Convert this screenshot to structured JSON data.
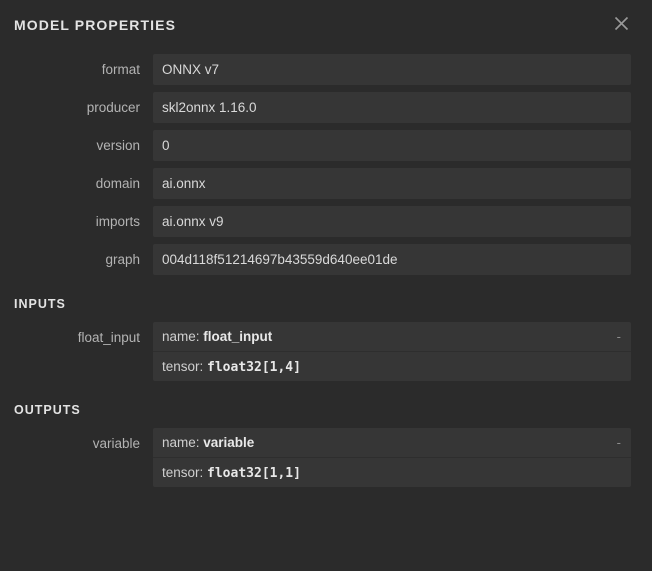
{
  "panel": {
    "title": "MODEL PROPERTIES",
    "close_icon": "close-icon"
  },
  "properties": [
    {
      "label": "format",
      "value": "ONNX v7"
    },
    {
      "label": "producer",
      "value": "skl2onnx 1.16.0"
    },
    {
      "label": "version",
      "value": "0"
    },
    {
      "label": "domain",
      "value": "ai.onnx"
    },
    {
      "label": "imports",
      "value": "ai.onnx v9"
    },
    {
      "label": "graph",
      "value": "004d118f51214697b43559d640ee01de"
    }
  ],
  "inputs": {
    "header": "INPUTS",
    "items": [
      {
        "label": "float_input",
        "name_key": "name:",
        "name_value": "float_input",
        "tensor_key": "tensor:",
        "tensor_value": "float32[1,4]",
        "trailing": "-"
      }
    ]
  },
  "outputs": {
    "header": "OUTPUTS",
    "items": [
      {
        "label": "variable",
        "name_key": "name:",
        "name_value": "variable",
        "tensor_key": "tensor:",
        "tensor_value": "float32[1,1]",
        "trailing": "-"
      }
    ]
  },
  "colors": {
    "background": "#2b2b2b",
    "field_background": "#363636",
    "text_primary": "#e3e3e3",
    "text_label": "#b3b3b3"
  }
}
